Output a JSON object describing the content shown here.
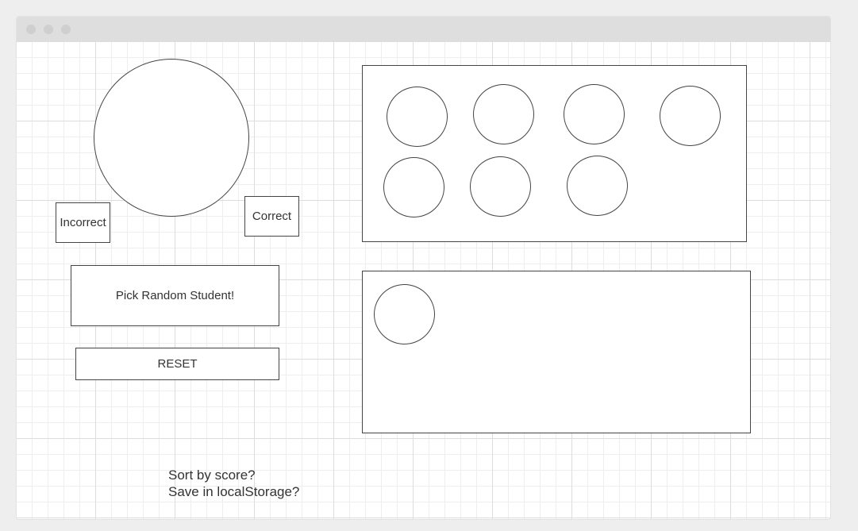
{
  "buttons": {
    "incorrect": "Incorrect",
    "correct": "Correct",
    "pick_random": "Pick Random Student!",
    "reset": "RESET"
  },
  "notes": [
    "Sort by score?",
    "Save in localStorage?"
  ],
  "student_pool_count": 7,
  "picked_students_count": 1
}
